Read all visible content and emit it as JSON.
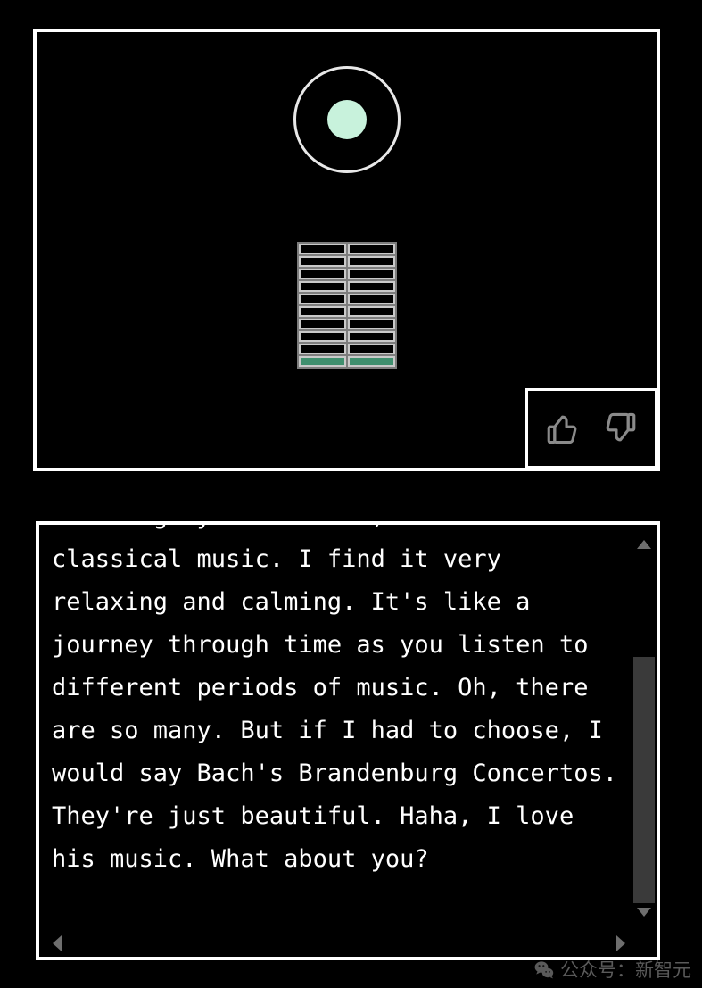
{
  "avatar_panel": {
    "name": "voice-assistant-avatar",
    "eye": {
      "icon": "circle-pupil-icon",
      "ring_color": "#e8e8e8",
      "pupil_color": "#c8f2dc"
    },
    "level_meter": {
      "icon": "level-meter-icon",
      "rows": 10,
      "columns": 2,
      "lit_rows": 1,
      "off_color": "#000000",
      "border_color": "#c9c9c9",
      "on_color": "#3f8f6e",
      "frame_color": "#7d7d7d"
    },
    "feedback": {
      "thumbs_up": {
        "icon": "thumbs-up-icon",
        "label": "Thumbs up",
        "color": "#8a8a8a"
      },
      "thumbs_down": {
        "icon": "thumbs-down-icon",
        "label": "Thumbs down",
        "color": "#8a8a8a"
      }
    }
  },
  "transcript_panel": {
    "name": "conversation-transcript",
    "text": "soothing my soul. Well, I love classical music. I find it very relaxing and calming. It's like a journey through time as you listen to different periods of music. Oh, there are so many. But if I had to choose, I would say Bach's Brandenburg Concertos. They're just beautiful. Haha, I love his music. What about you?",
    "text_color": "#ffffff",
    "vertical_scrollbar": {
      "up_arrow_icon": "triangle-up-icon",
      "down_arrow_icon": "triangle-down-icon",
      "thumb_color": "#3a3a3a",
      "arrow_color": "#6e6e6e"
    },
    "horizontal_scrollbar": {
      "left_arrow_icon": "triangle-left-icon",
      "right_arrow_icon": "triangle-right-icon",
      "arrow_color": "#6e6e6e"
    }
  },
  "watermark": {
    "logo_icon": "wechat-logo-icon",
    "text": "公众号：新智元",
    "color": "#5a5a5a"
  }
}
